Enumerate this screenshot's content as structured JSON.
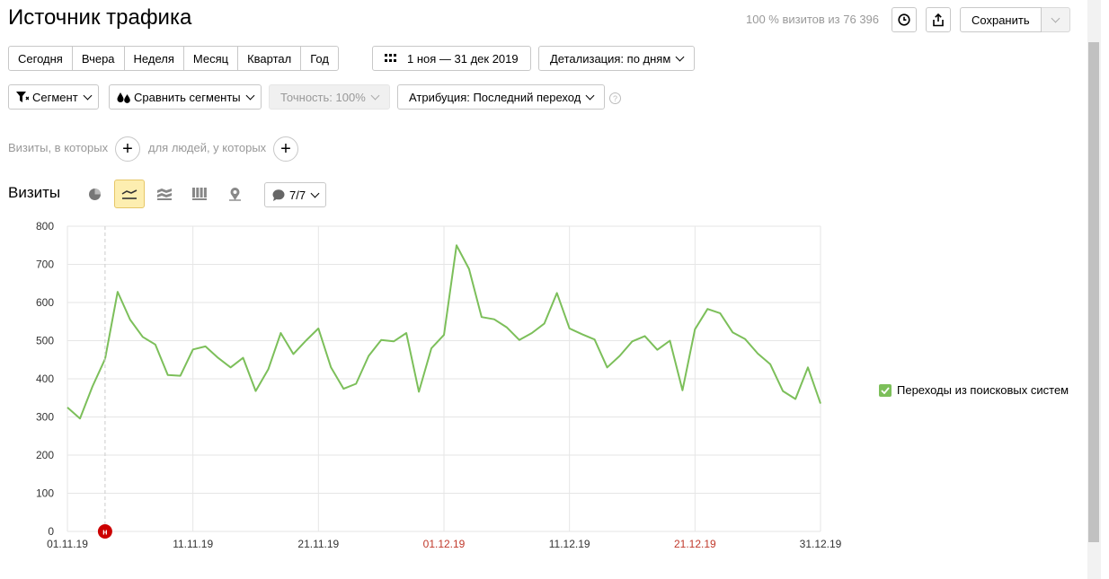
{
  "header": {
    "title": "Источник трафика",
    "visits_info": "100 % визитов из 76 396",
    "save_label": "Сохранить"
  },
  "period": {
    "buttons": [
      "Сегодня",
      "Вчера",
      "Неделя",
      "Месяц",
      "Квартал",
      "Год"
    ],
    "date_range": "1 ноя — 31 дек 2019",
    "detail_label": "Детализация: по дням"
  },
  "filters": {
    "segment_label": "Сегмент",
    "compare_label": "Сравнить сегменты",
    "accuracy_label": "Точность: 100%",
    "attribution_label": "Атрибуция: Последний переход",
    "help": "?"
  },
  "conditions": {
    "visits_text": "Визиты, в которых",
    "people_text": "для людей, у которых",
    "plus": "+"
  },
  "chart_section": {
    "title": "Визиты",
    "annotations_label": "7/7",
    "marker_letter": "н",
    "icons": [
      "pie-chart-icon",
      "line-chart-icon",
      "area-chart-icon",
      "bar-chart-icon",
      "map-icon"
    ],
    "active_view": "line-chart-icon"
  },
  "colors": {
    "line": "#7cbf5a",
    "grid": "#e6e6e6",
    "weekend_tick": "#c0392b",
    "marker": "#cc0000",
    "active_view_bg": "#fdeeb0"
  },
  "chart_data": {
    "type": "line",
    "title": "",
    "xlabel": "",
    "ylabel": "",
    "ylim": [
      0,
      800
    ],
    "yticks": [
      "0",
      "100",
      "200",
      "300",
      "400",
      "500",
      "600",
      "700",
      "800"
    ],
    "xticks": [
      {
        "label": "01.11.19",
        "index": 0,
        "weekend": false
      },
      {
        "label": "11.11.19",
        "index": 10,
        "weekend": false
      },
      {
        "label": "21.11.19",
        "index": 20,
        "weekend": false
      },
      {
        "label": "01.12.19",
        "index": 30,
        "weekend": true
      },
      {
        "label": "11.12.19",
        "index": 40,
        "weekend": false
      },
      {
        "label": "21.12.19",
        "index": 50,
        "weekend": true
      },
      {
        "label": "31.12.19",
        "index": 60,
        "weekend": false
      }
    ],
    "marker_index": 3,
    "series": [
      {
        "name": "Переходы из поисковых систем",
        "values": [
          325,
          296,
          380,
          452,
          628,
          555,
          510,
          490,
          410,
          408,
          477,
          485,
          455,
          430,
          455,
          368,
          425,
          520,
          465,
          500,
          532,
          430,
          374,
          387,
          460,
          502,
          498,
          520,
          366,
          480,
          515,
          750,
          688,
          562,
          556,
          535,
          502,
          520,
          545,
          625,
          532,
          517,
          503,
          430,
          460,
          498,
          512,
          476,
          500,
          370,
          530,
          583,
          572,
          522,
          504,
          466,
          438,
          368,
          347,
          430,
          335
        ]
      }
    ]
  }
}
